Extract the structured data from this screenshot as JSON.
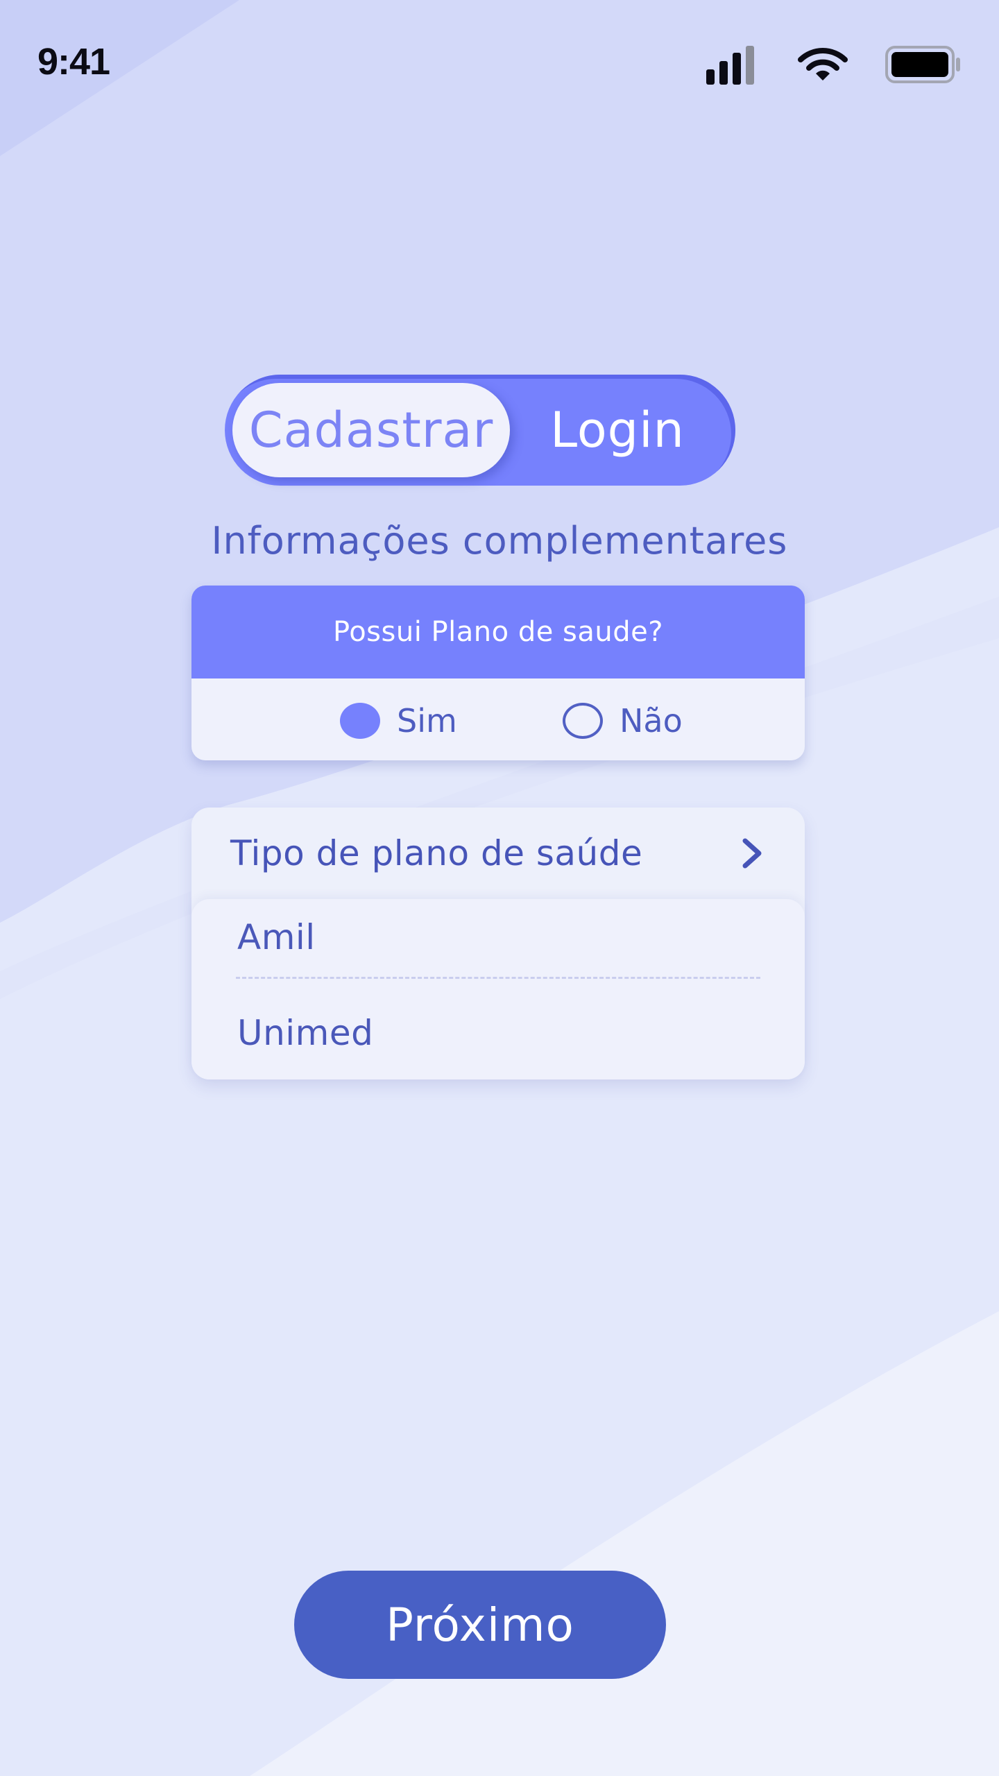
{
  "status_bar": {
    "time": "9:41",
    "icons": [
      "cellular-signal-icon",
      "wifi-icon",
      "battery-icon"
    ]
  },
  "auth_toggle": {
    "active_label": "Cadastrar",
    "inactive_label": "Login"
  },
  "section_title": "Informações complementares",
  "health_question": {
    "title": "Possui Plano de saude?",
    "options": [
      {
        "label": "Sim",
        "selected": true
      },
      {
        "label": "Não",
        "selected": false
      }
    ]
  },
  "plan_dropdown": {
    "label": "Tipo de plano de saúde",
    "options": [
      "Amil",
      "Unimed"
    ]
  },
  "next_button": {
    "label": "Próximo"
  },
  "colors": {
    "primary": "#7681fd",
    "button": "#4860c5",
    "text_accent": "#4d5cc0",
    "background": "#e3e8fb"
  }
}
